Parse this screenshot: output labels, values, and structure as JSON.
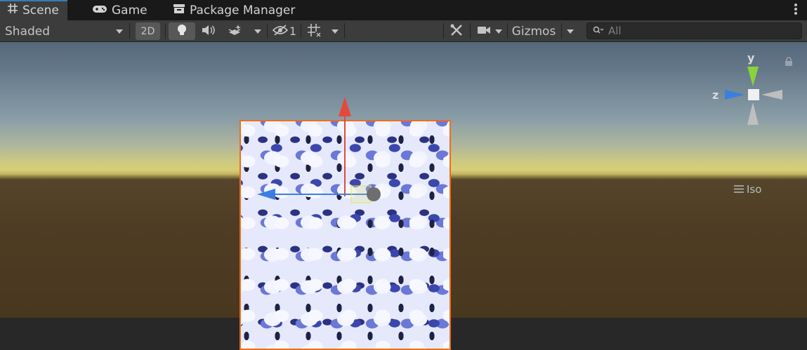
{
  "tabs": [
    {
      "label": "Scene",
      "icon": "grid-icon",
      "active": true
    },
    {
      "label": "Game",
      "icon": "gamepad-icon",
      "active": false
    },
    {
      "label": "Package Manager",
      "icon": "package-icon",
      "active": false
    }
  ],
  "toolbar": {
    "shading_mode": "Shaded",
    "mode_2d": "2D",
    "hidden_count": "1",
    "gizmos_label": "Gizmos",
    "search_placeholder": "All"
  },
  "orientation_gizmo": {
    "y_label": "y",
    "z_label": "z",
    "projection_label": "Iso"
  },
  "colors": {
    "selection_outline": "#f06d1a",
    "x_axis": "#e34a3c",
    "y_axis": "#8ad33b",
    "z_axis": "#3c7ee0",
    "tab_accent": "#3a79bb"
  }
}
